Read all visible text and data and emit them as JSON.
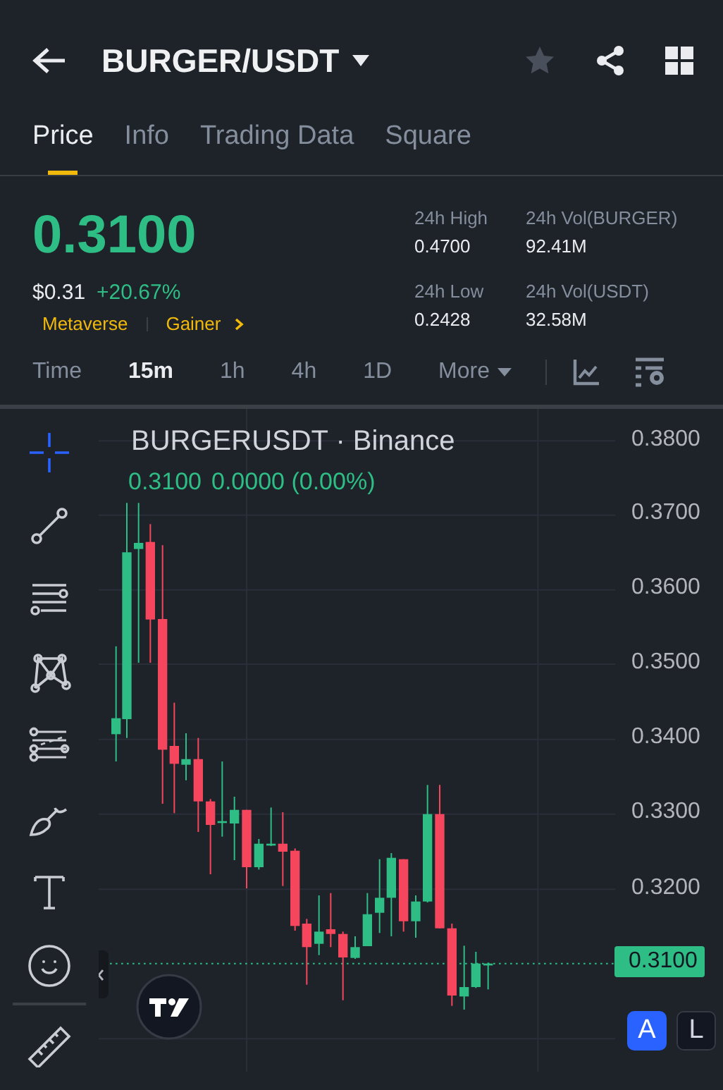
{
  "header": {
    "title": "BURGER/USDT"
  },
  "tabs": [
    {
      "label": "Price",
      "selected": true
    },
    {
      "label": "Info",
      "selected": false
    },
    {
      "label": "Trading Data",
      "selected": false
    },
    {
      "label": "Square",
      "selected": false
    }
  ],
  "price": {
    "last": "0.3100",
    "usd": "$0.31",
    "change": "+20.67%",
    "tags": [
      "Metaverse",
      "Gainer"
    ]
  },
  "stats": [
    {
      "label": "24h High",
      "value": "0.4700"
    },
    {
      "label": "24h Vol(BURGER)",
      "value": "92.41M"
    },
    {
      "label": "24h Low",
      "value": "0.2428"
    },
    {
      "label": "24h Vol(USDT)",
      "value": "32.58M"
    }
  ],
  "intervals": [
    {
      "label": "Time",
      "selected": false
    },
    {
      "label": "15m",
      "selected": true
    },
    {
      "label": "1h",
      "selected": false
    },
    {
      "label": "4h",
      "selected": false
    },
    {
      "label": "1D",
      "selected": false
    }
  ],
  "more": "More",
  "tools": [
    {
      "kind": "crosshair",
      "selected": true
    },
    {
      "kind": "trendline",
      "selected": false
    },
    {
      "kind": "lines",
      "selected": false
    },
    {
      "kind": "pattern",
      "selected": false
    },
    {
      "kind": "levels",
      "selected": false
    },
    {
      "kind": "brush",
      "selected": false
    },
    {
      "kind": "text",
      "selected": false
    },
    {
      "kind": "emoji",
      "selected": false
    },
    {
      "kind": "ruler",
      "selected": false
    }
  ],
  "chart": {
    "symbol": "BURGERUSDT · Binance",
    "legend_price": "0.3100",
    "legend_change": "0.0000 (0.00%)",
    "price_ticks": [
      "0.3800",
      "0.3700",
      "0.3600",
      "0.3500",
      "0.3400",
      "0.3300",
      "0.3200"
    ],
    "last_price": "0.3100",
    "scale_buttons": [
      {
        "label": "A",
        "selected": true
      },
      {
        "label": "L",
        "selected": false
      }
    ]
  }
}
